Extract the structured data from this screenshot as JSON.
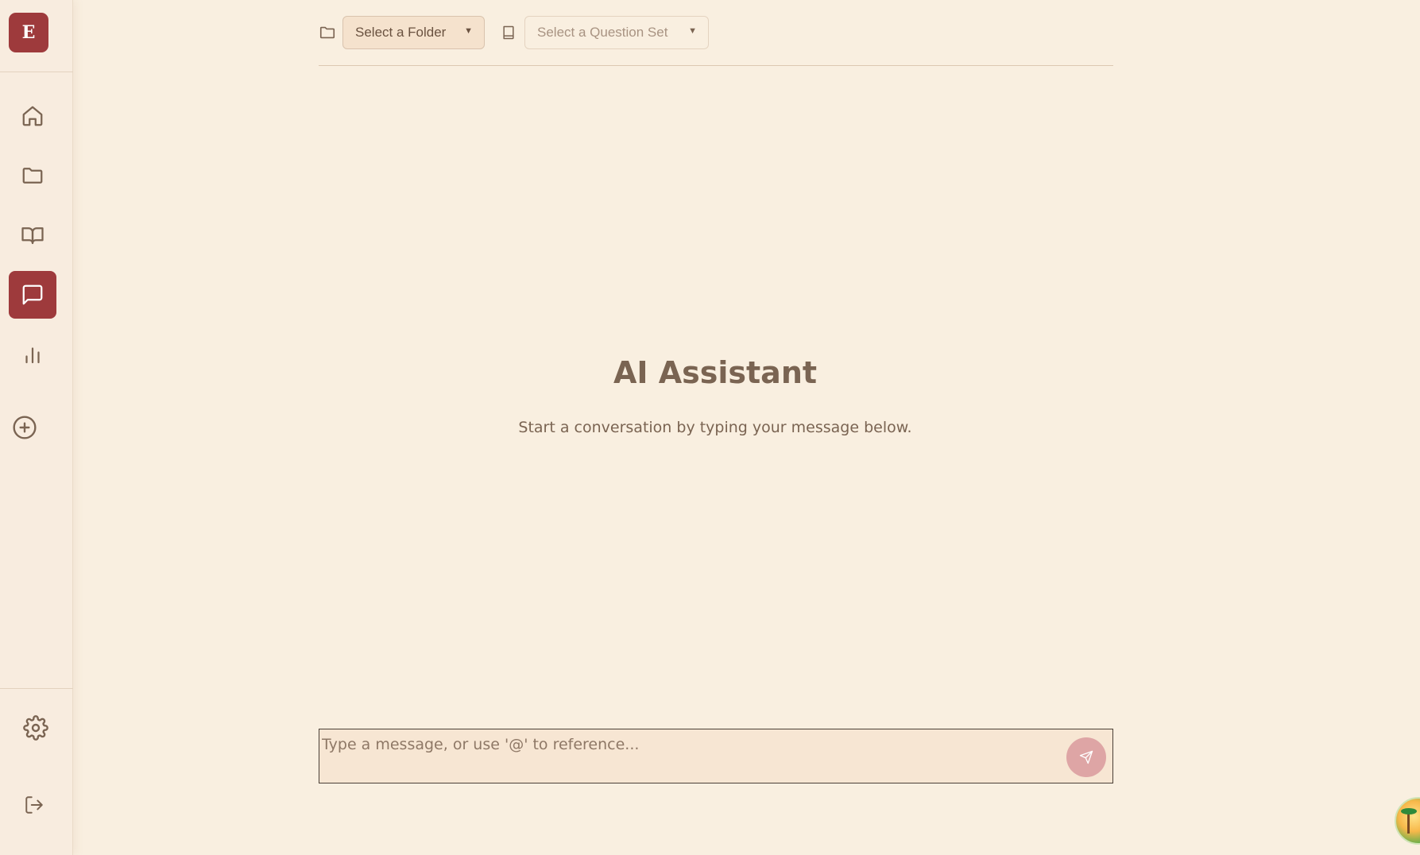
{
  "sidebar": {
    "logo_letter": "E",
    "items": [
      {
        "name": "home",
        "icon": "home-icon",
        "active": false
      },
      {
        "name": "folders",
        "icon": "folder-icon",
        "active": false
      },
      {
        "name": "question-sets",
        "icon": "book-open-icon",
        "active": false
      },
      {
        "name": "chat",
        "icon": "message-square-icon",
        "active": true
      },
      {
        "name": "analytics",
        "icon": "bar-chart-icon",
        "active": false
      }
    ],
    "add_icon": "plus-circle-icon",
    "settings_icon": "gear-icon",
    "logout_icon": "logout-icon",
    "accent_color": "#9e3a3c"
  },
  "toolbar": {
    "folder_select_label": "Select a Folder",
    "question_set_select_label": "Select a Question Set",
    "folder_icon": "folder-icon",
    "question_set_icon": "book-icon"
  },
  "main": {
    "title": "AI Assistant",
    "subtitle": "Start a conversation by typing your message below."
  },
  "composer": {
    "placeholder": "Type a message, or use '@' to reference...",
    "value": "",
    "send_icon": "send-icon",
    "send_color": "#dea5a5"
  },
  "floating": {
    "avatar_icon": "beach-avatar-icon"
  }
}
